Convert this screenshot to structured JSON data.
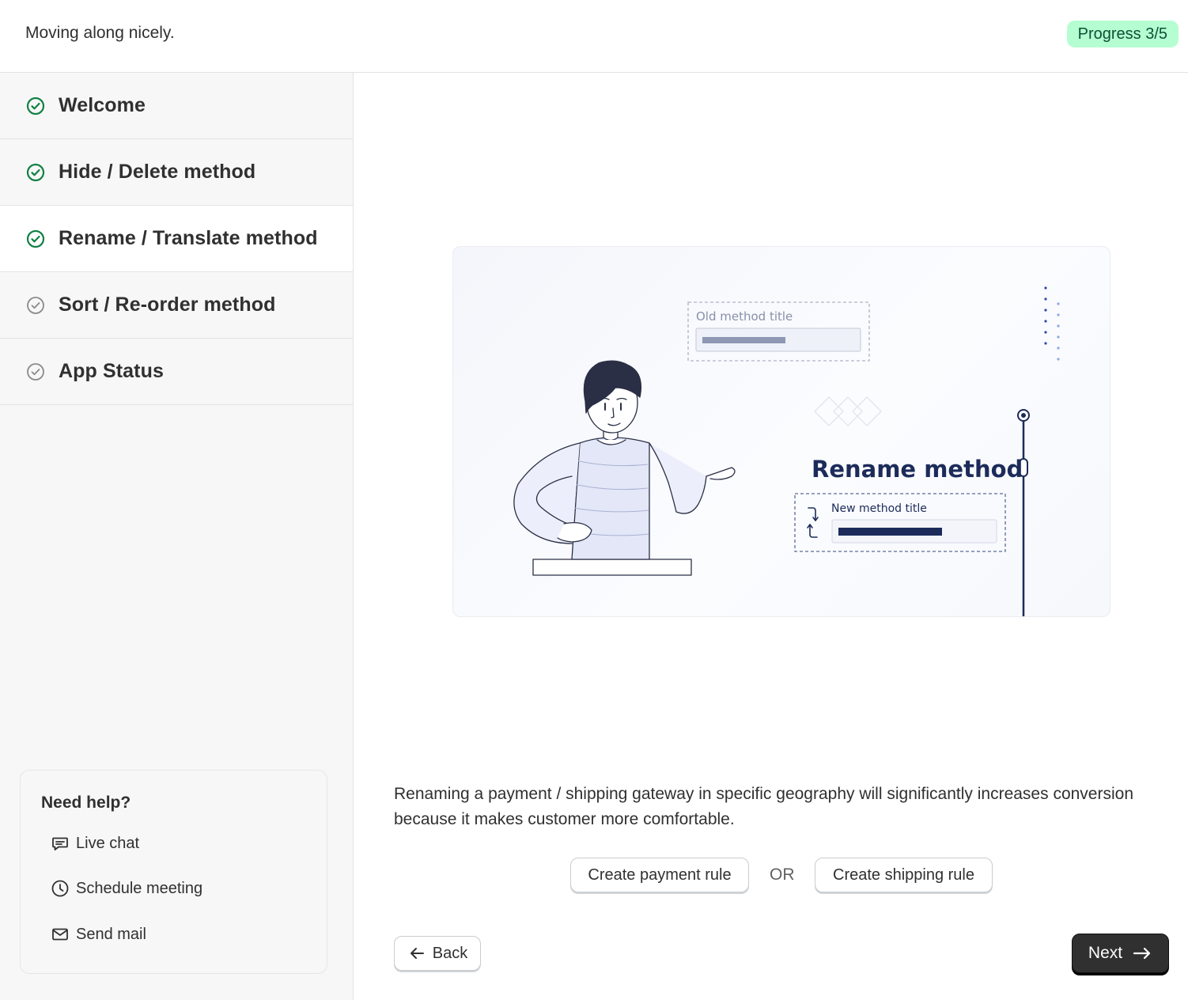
{
  "header": {
    "title": "Moving along nicely.",
    "progress_label": "Progress 3/5"
  },
  "steps": [
    {
      "label": "Welcome",
      "status": "complete"
    },
    {
      "label": "Hide / Delete method",
      "status": "complete"
    },
    {
      "label": "Rename / Translate method",
      "status": "complete",
      "active": true
    },
    {
      "label": "Sort / Re-order method",
      "status": "pending"
    },
    {
      "label": "App Status",
      "status": "pending"
    }
  ],
  "help": {
    "title": "Need help?",
    "items": [
      {
        "label": "Live chat",
        "icon": "chat-icon"
      },
      {
        "label": "Schedule meeting",
        "icon": "clock-icon"
      },
      {
        "label": "Send mail",
        "icon": "mail-icon"
      }
    ]
  },
  "illustration": {
    "old_field_label": "Old method title",
    "heading": "Rename method",
    "new_field_label": "New method title"
  },
  "main": {
    "description": "Renaming a payment / shipping gateway in specific geography will significantly increases conversion because it makes customer more comfortable.",
    "create_payment_label": "Create payment rule",
    "or_label": "OR",
    "create_shipping_label": "Create shipping rule",
    "back_label": "Back",
    "next_label": "Next"
  },
  "colors": {
    "complete_check": "#108043",
    "pending_check": "#8a8a8a",
    "progress_badge_bg": "#b4fed2",
    "illustration_navy": "#1c2b5a"
  }
}
